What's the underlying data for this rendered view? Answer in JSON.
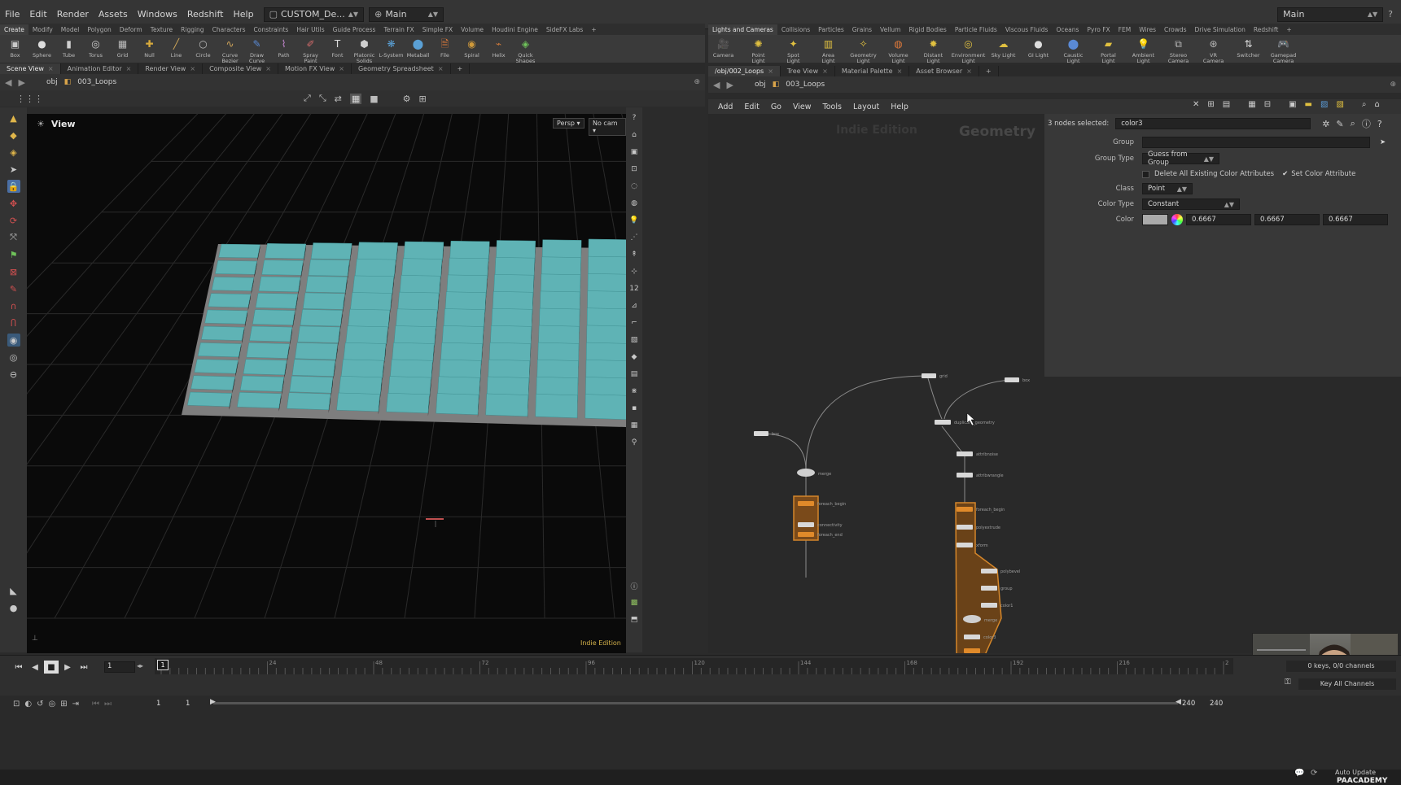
{
  "menu": {
    "items": [
      "File",
      "Edit",
      "Render",
      "Assets",
      "Windows",
      "Redshift",
      "Help"
    ],
    "desktop_name": "CUSTOM_De...",
    "main_label": "Main",
    "right_main_label": "Main"
  },
  "left_shelf": {
    "tabs": [
      "Create",
      "Modify",
      "Model",
      "Polygon",
      "Deform",
      "Texture",
      "Rigging",
      "Characters",
      "Constraints",
      "Hair Utils",
      "Guide Process",
      "Terrain FX",
      "Simple FX",
      "Volume",
      "Houdini Engine",
      "SideFX Labs"
    ],
    "tools": [
      {
        "label": "Box",
        "icon": "box-icon"
      },
      {
        "label": "Sphere",
        "icon": "sphere-icon"
      },
      {
        "label": "Tube",
        "icon": "tube-icon"
      },
      {
        "label": "Torus",
        "icon": "torus-icon"
      },
      {
        "label": "Grid",
        "icon": "grid-icon"
      },
      {
        "label": "Null",
        "icon": "null-icon"
      },
      {
        "label": "Line",
        "icon": "line-icon"
      },
      {
        "label": "Circle",
        "icon": "circle-icon"
      },
      {
        "label": "Curve Bezier",
        "icon": "curve-bezier-icon"
      },
      {
        "label": "Draw Curve",
        "icon": "draw-curve-icon"
      },
      {
        "label": "Path",
        "icon": "path-icon"
      },
      {
        "label": "Spray Paint",
        "icon": "spray-paint-icon"
      },
      {
        "label": "Font",
        "icon": "font-icon"
      },
      {
        "label": "Platonic Solids",
        "icon": "platonic-solids-icon"
      },
      {
        "label": "L-System",
        "icon": "l-system-icon"
      },
      {
        "label": "Metaball",
        "icon": "metaball-icon"
      },
      {
        "label": "File",
        "icon": "file-icon"
      },
      {
        "label": "Spiral",
        "icon": "spiral-icon"
      },
      {
        "label": "Helix",
        "icon": "helix-icon"
      },
      {
        "label": "Quick Shapes",
        "icon": "quick-shapes-icon"
      }
    ]
  },
  "right_shelf": {
    "tabs": [
      "Lights and Cameras",
      "Collisions",
      "Particles",
      "Grains",
      "Vellum",
      "Rigid Bodies",
      "Particle Fluids",
      "Viscous Fluids",
      "Oceans",
      "Pyro FX",
      "FEM",
      "Wires",
      "Crowds",
      "Drive Simulation",
      "Redshift"
    ],
    "tools": [
      {
        "label": "Camera",
        "icon": "camera-icon"
      },
      {
        "label": "Point Light",
        "icon": "point-light-icon"
      },
      {
        "label": "Spot Light",
        "icon": "spot-light-icon"
      },
      {
        "label": "Area Light",
        "icon": "area-light-icon"
      },
      {
        "label": "Geometry Light",
        "icon": "geometry-light-icon"
      },
      {
        "label": "Volume Light",
        "icon": "volume-light-icon"
      },
      {
        "label": "Distant Light",
        "icon": "distant-light-icon"
      },
      {
        "label": "Environment Light",
        "icon": "environment-light-icon"
      },
      {
        "label": "Sky Light",
        "icon": "sky-light-icon"
      },
      {
        "label": "GI Light",
        "icon": "gi-light-icon"
      },
      {
        "label": "Caustic Light",
        "icon": "caustic-light-icon"
      },
      {
        "label": "Portal Light",
        "icon": "portal-light-icon"
      },
      {
        "label": "Ambient Light",
        "icon": "ambient-light-icon"
      },
      {
        "label": "Stereo Camera",
        "icon": "stereo-camera-icon"
      },
      {
        "label": "VR Camera",
        "icon": "vr-camera-icon"
      },
      {
        "label": "Switcher",
        "icon": "switcher-icon"
      },
      {
        "label": "Gamepad Camera",
        "icon": "gamepad-camera-icon"
      }
    ]
  },
  "left_pane": {
    "tabs": [
      "Scene View",
      "Animation Editor",
      "Render View",
      "Composite View",
      "Motion FX View",
      "Geometry Spreadsheet"
    ],
    "path_obj": "obj",
    "path_node": "003_Loops",
    "view_label": "View",
    "persp_label": "Persp",
    "cam_label": "No cam",
    "indie_label": "Indie Edition"
  },
  "right_pane": {
    "tabs": [
      "/obj/002_Loops",
      "Tree View",
      "Material Palette",
      "Asset Browser"
    ],
    "path_obj": "obj",
    "path_node": "003_Loops",
    "menus": [
      "Add",
      "Edit",
      "Go",
      "View",
      "Tools",
      "Layout",
      "Help"
    ],
    "watermark_indie": "Indie Edition",
    "watermark_context": "Geometry"
  },
  "params": {
    "selected_label": "3 nodes selected:",
    "node_name": "color3",
    "group_label": "Group",
    "group_value": "",
    "group_type_label": "Group Type",
    "group_type_value": "Guess from Group",
    "delete_attrs_label": "Delete All Existing Color Attributes",
    "set_color_label": "Set Color Attribute",
    "class_label": "Class",
    "class_value": "Point",
    "color_type_label": "Color Type",
    "color_type_value": "Constant",
    "color_label": "Color",
    "color_values": [
      "0.6667",
      "0.6667",
      "0.6667"
    ]
  },
  "timeline": {
    "current_frame": "1",
    "start_frame": "1",
    "start_frame2": "1",
    "end_frame": "240",
    "end_frame2": "240",
    "ticks": [
      "1",
      "24",
      "48",
      "72",
      "96",
      "120",
      "144",
      "168",
      "192",
      "216",
      "2"
    ],
    "keys_label": "0 keys, 0/0 channels",
    "key_all_label": "Key All Channels",
    "auto_update_label": "Auto Update",
    "watermark": "PAACADEMY"
  },
  "colors": {
    "tile": "#5fb3b5",
    "node_selected": "#d4862a",
    "network_bg": "#292929"
  }
}
